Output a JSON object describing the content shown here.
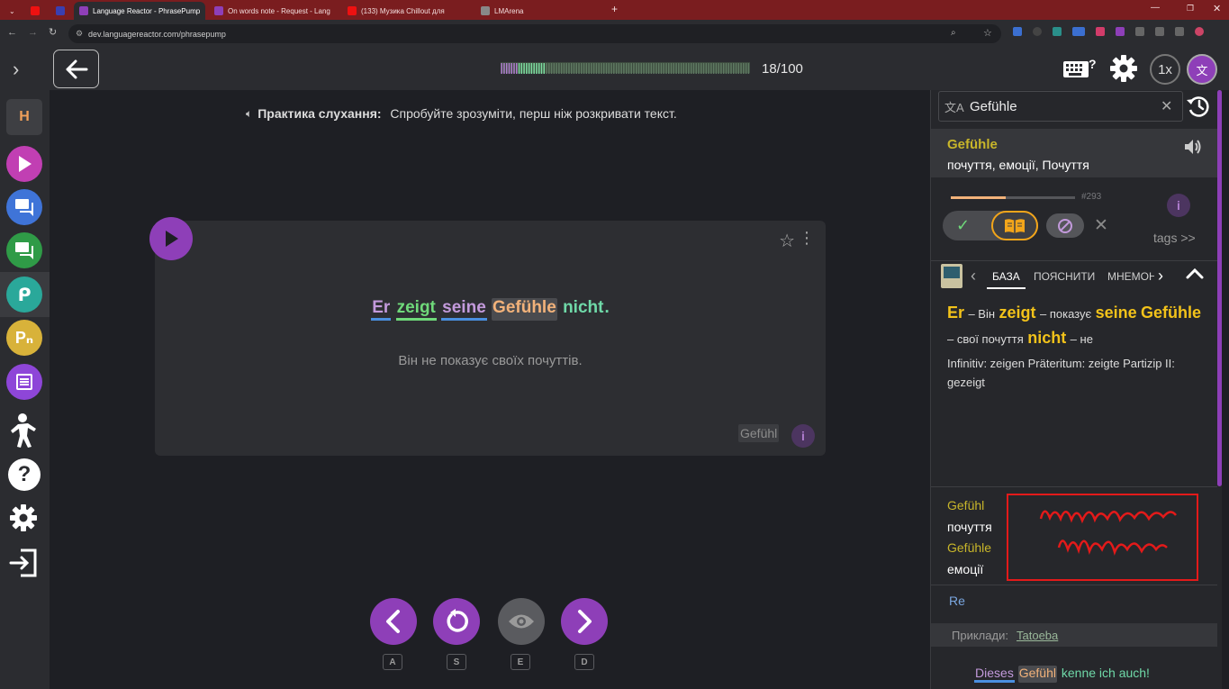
{
  "browser": {
    "tabs": [
      {
        "label": "",
        "favicon": "#cc3333"
      },
      {
        "label": "",
        "favicon": "#cc0000"
      },
      {
        "label": "",
        "favicon": "#3a3fb0"
      },
      {
        "label": "Language Reactor - PhrasePump",
        "favicon": "#8e3fb8"
      },
      {
        "label": "On words note - Request - Lang",
        "favicon": "#8e3fb8"
      },
      {
        "label": "(133) Музика Chillout для ",
        "favicon": "#e11"
      },
      {
        "label": "LMArena",
        "favicon": "#888"
      }
    ],
    "url": "dev.languagereactor.com/phrasepump"
  },
  "header": {
    "progress": "18/100",
    "progress_fraction": 0.18,
    "speed": "1x"
  },
  "sidebar": {
    "avatar_letter": "H",
    "items": [
      "play-icon",
      "chat-icon",
      "chat-icon",
      "phrasepump-icon",
      "phrasepump-n-icon",
      "list-icon",
      "person-icon",
      "help-icon",
      "settings-icon",
      "logout-icon"
    ]
  },
  "main": {
    "hint_bold": "Практика слухання:",
    "hint_rest": " Спробуйте зрозуміти, перш ніж розкривати текст.",
    "sentence": [
      {
        "text": "Er",
        "color": "#c39adc",
        "underline": "#4a8fe0"
      },
      {
        "text": "zeigt",
        "color": "#6fd97a",
        "underline": "#6fd97a"
      },
      {
        "text": "seine",
        "color": "#c39adc",
        "underline": "#4a8fe0"
      },
      {
        "text": "Gefühle",
        "color": "#f2b27a",
        "underline": ""
      },
      {
        "text": "nicht",
        "color": "#6fd9a8",
        "underline": ""
      }
    ],
    "sentence_end": ".",
    "translation": "Він не показує своїх почуттів.",
    "lemma_chip": "Gefühl",
    "keys": [
      "A",
      "S",
      "E",
      "D"
    ]
  },
  "panel": {
    "search_value": "Gefühle",
    "word": "Gefühle",
    "meaning": "почуття, емоції, Почуття",
    "rank": "#293",
    "tags": "tags >>",
    "tabs": [
      "БАЗА",
      "ПОЯСНИТИ",
      "МНЕМОН"
    ],
    "gloss": [
      {
        "de": "Er",
        "uk": "– Він"
      },
      {
        "de": "zeigt",
        "uk": "– показує"
      },
      {
        "de": "seine",
        "uk": ""
      },
      {
        "de": "Gefühle",
        "uk": "– свої почуття"
      },
      {
        "de": "nicht",
        "uk": "– не"
      }
    ],
    "grammar": "Infinitiv: zeigen Präteritum: zeigte Partizip II: gezeigt",
    "dict": [
      {
        "de": "Gefühl",
        "uk": "почуття"
      },
      {
        "de": "Gefühle",
        "uk": "емоції"
      }
    ],
    "re": "Re",
    "examples_label": "Приклади:",
    "examples_source": "Tatoeba",
    "example": [
      {
        "text": "Dieses",
        "color": "#c39adc",
        "underline": "#4a8fe0"
      },
      {
        "text": "Gefühl",
        "color": "#f2b27a",
        "underline": ""
      },
      {
        "text": "kenne ich auch!",
        "color": "#6fd9a8",
        "underline": ""
      }
    ]
  }
}
